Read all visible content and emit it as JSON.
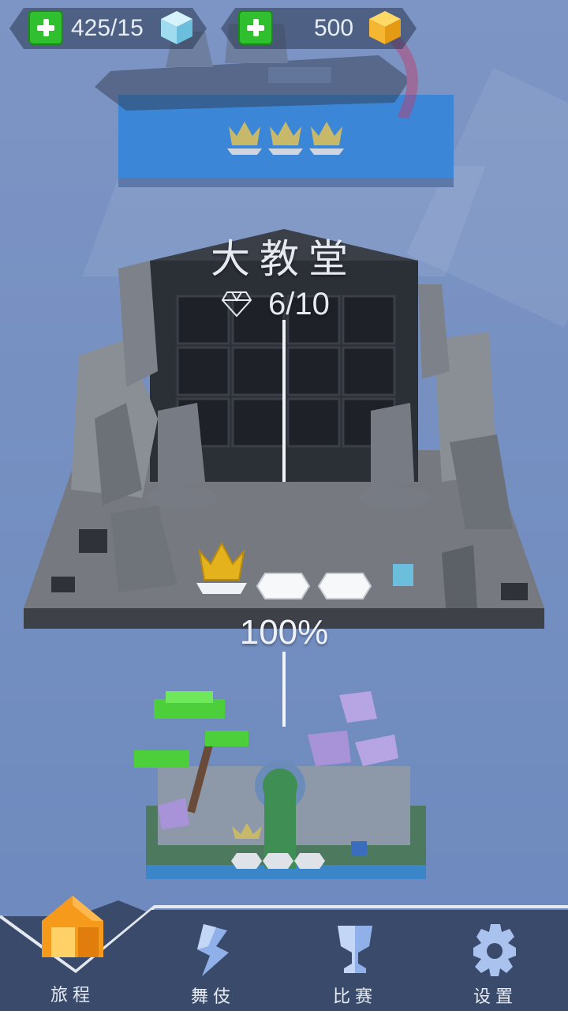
{
  "currency": {
    "energy_value": "425/15",
    "gold_value": "500"
  },
  "levels": {
    "current": {
      "title": "大教堂",
      "gems": "6/10",
      "progress": "100%",
      "crowns_earned": 1,
      "crowns_total": 3
    }
  },
  "nav": {
    "items": [
      {
        "label": "旅程",
        "icon": "house-icon"
      },
      {
        "label": "舞伎",
        "icon": "lightning-icon"
      },
      {
        "label": "比赛",
        "icon": "trophy-icon"
      },
      {
        "label": "设置",
        "icon": "gear-icon"
      }
    ]
  },
  "colors": {
    "background": "#7690c2",
    "plus_green": "#2fbf2f",
    "platform_blue": "#3b86d6",
    "nav_bg": "#3a4a6b",
    "home_orange": "#f59a1b",
    "gold": "#f5b731",
    "ice_blue": "#9fdcf0"
  }
}
